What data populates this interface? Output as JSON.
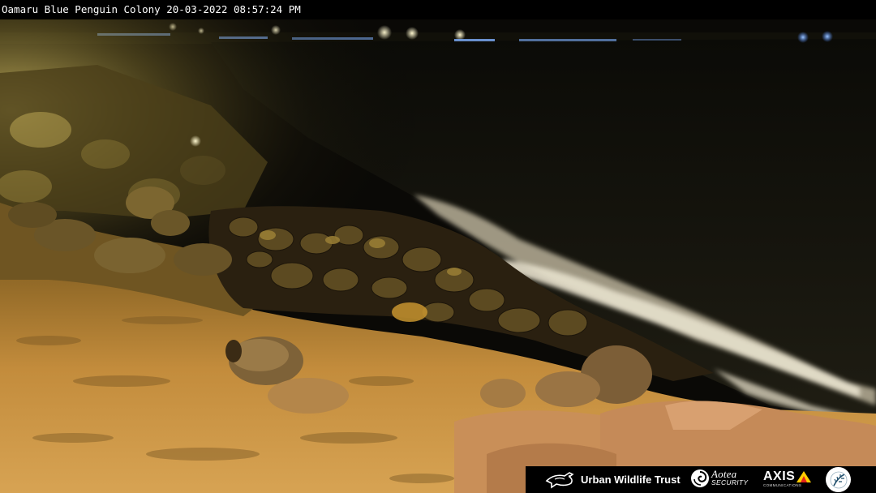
{
  "overlay": {
    "location": "Oamaru Blue Penguin Colony",
    "date": "20-03-2022",
    "time": "08:57:24 PM"
  },
  "scene": {
    "colors": {
      "sky": "#0b0a06",
      "sea": "#16140c",
      "foam": "#cfc9b6",
      "rock_dark": "#3a2c10",
      "rock_lit": "#c8933e",
      "ground_lit": "#d9a14a",
      "floodlight": "#fff1a8",
      "city_light_blue": "#6aa8ff",
      "city_light_warm": "#fff4c8"
    }
  },
  "sponsors": {
    "urban_wildlife_trust": {
      "label": "Urban Wildlife Trust",
      "icon": "penguin-bird-icon"
    },
    "aotea_security": {
      "name": "Aotea",
      "sub": "SECURITY",
      "icon": "aotea-swirl-icon"
    },
    "axis": {
      "name": "AXIS",
      "sub": "COMMUNICATIONS",
      "accent": "#ffcc00",
      "accent2": "#e2231a"
    },
    "doc": {
      "icon": "doc-fern-icon"
    }
  }
}
